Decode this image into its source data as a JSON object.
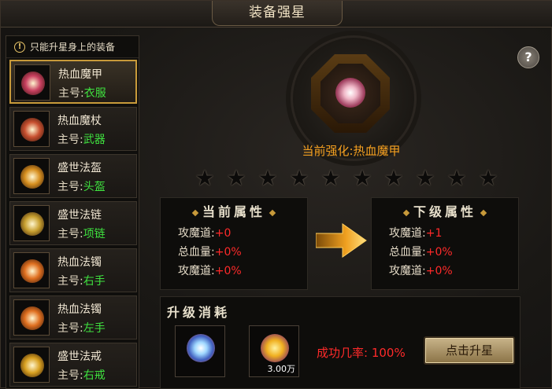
{
  "window": {
    "title": "装备强星"
  },
  "notice": {
    "icon": "warning-icon",
    "text": "只能升星身上的装备"
  },
  "items": [
    {
      "name": "热血魔甲",
      "slot_prefix": "主号:",
      "slot": "衣服",
      "icon": "armor-icon",
      "color": "#c84060",
      "selected": true
    },
    {
      "name": "热血魔杖",
      "slot_prefix": "主号:",
      "slot": "武器",
      "icon": "staff-icon",
      "color": "#c85030",
      "selected": false
    },
    {
      "name": "盛世法盔",
      "slot_prefix": "主号:",
      "slot": "头盔",
      "icon": "helmet-icon",
      "color": "#d89020",
      "selected": false
    },
    {
      "name": "盛世法链",
      "slot_prefix": "主号:",
      "slot": "项链",
      "icon": "necklace-icon",
      "color": "#c8a030",
      "selected": false
    },
    {
      "name": "热血法镯",
      "slot_prefix": "主号:",
      "slot": "右手",
      "icon": "bracelet-icon",
      "color": "#e07020",
      "selected": false
    },
    {
      "name": "热血法镯",
      "slot_prefix": "主号:",
      "slot": "左手",
      "icon": "bracelet-icon",
      "color": "#e07020",
      "selected": false
    },
    {
      "name": "盛世法戒",
      "slot_prefix": "主号:",
      "slot": "右戒",
      "icon": "ring-icon",
      "color": "#d8a020",
      "selected": false
    }
  ],
  "current": {
    "label": "当前强化:热血魔甲"
  },
  "stars": {
    "filled": 0,
    "total": 10
  },
  "current_attrs": {
    "title": "当前属性",
    "rows": [
      {
        "label": "攻魔道:",
        "value": "+0"
      },
      {
        "label": "总血量:",
        "value": "+0%"
      },
      {
        "label": "攻魔道:",
        "value": "+0%"
      }
    ]
  },
  "next_attrs": {
    "title": "下级属性",
    "rows": [
      {
        "label": "攻魔道:",
        "value": "+1"
      },
      {
        "label": "总血量:",
        "value": "+0%"
      },
      {
        "label": "攻魔道:",
        "value": "+0%"
      }
    ]
  },
  "cost": {
    "title": "升级消耗",
    "material": {
      "icon": "crystal-icon"
    },
    "gold": {
      "icon": "gold-ingot-icon",
      "qty": "3.00万"
    },
    "success_rate": "成功几率: 100%",
    "button_label": "点击升星"
  },
  "help": {
    "icon": "help-icon",
    "label": "?"
  },
  "colors": {
    "accent_gold": "#c89a3a",
    "value_red": "#ff2a2a",
    "slot_green": "#3fe23f",
    "title_orange": "#f5a020"
  }
}
